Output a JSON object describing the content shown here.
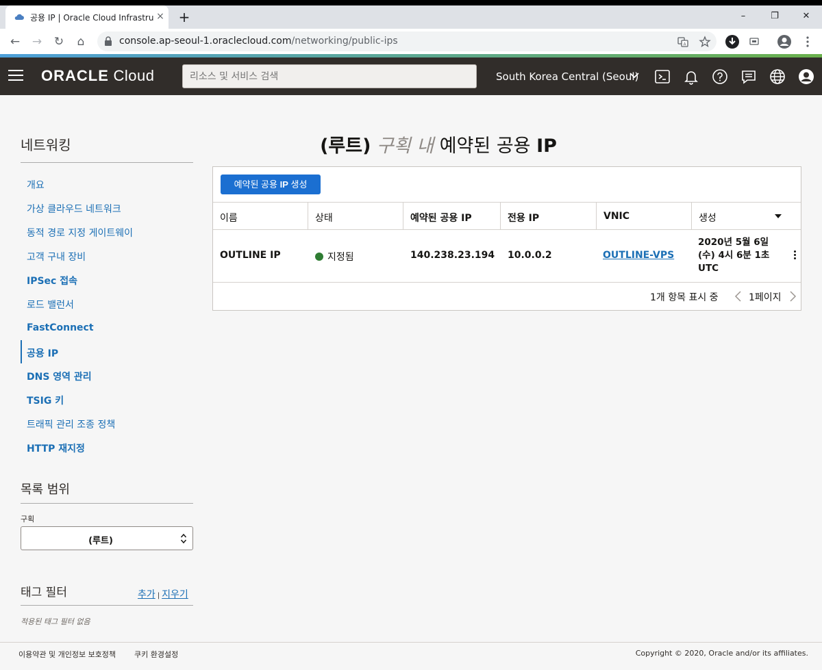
{
  "browser": {
    "tab_title": "공용 IP | Oracle Cloud Infrastruc",
    "tab_close": "×",
    "new_tab": "+",
    "window_controls": {
      "minimize": "–",
      "maximize": "❐",
      "close": "✕"
    },
    "url_host": "console.ap-seoul-1.oraclecloud.com",
    "url_path": "/networking/public-ips",
    "nav": {
      "back": "←",
      "forward": "→",
      "reload": "↻",
      "home": "⌂"
    },
    "toolbar_icons": [
      "translate-icon",
      "star-icon",
      "download-icon",
      "media-icon",
      "profile-icon",
      "menu-icon"
    ]
  },
  "header": {
    "brand_bold": "ORACLE",
    "brand_light": " Cloud",
    "search_placeholder": "리소스 및 서비스 검색",
    "region": "South Korea Central (Seoul)",
    "icons": [
      "cloud-shell-icon",
      "bell-icon",
      "help-icon",
      "chat-icon",
      "globe-icon",
      "user-icon"
    ]
  },
  "sidebar": {
    "title": "네트워킹",
    "items": [
      {
        "label": "개요",
        "bold": false
      },
      {
        "label": "가상 클라우드 네트워크",
        "bold": false
      },
      {
        "label": "동적 경로 지정 게이트웨이",
        "bold": false
      },
      {
        "label": "고객 구내 장비",
        "bold": false
      },
      {
        "label": "IPSec 접속",
        "bold": true
      },
      {
        "label": "로드 밸런서",
        "bold": false
      },
      {
        "label": "FastConnect",
        "bold": true
      },
      {
        "label": "공용 IP",
        "bold": true,
        "active": true
      },
      {
        "label": "DNS 영역 관리",
        "bold": true
      },
      {
        "label": "TSIG 키",
        "bold": true
      },
      {
        "label": "트래픽 관리 조종 정책",
        "bold": false
      },
      {
        "label": "HTTP 재지정",
        "bold": true
      }
    ],
    "scope_title": "목록 범위",
    "compartment_label": "구획",
    "compartment_value": "(루트)",
    "tag_filter_title": "태그 필터",
    "tag_add": "추가",
    "tag_sep": "|",
    "tag_clear": "지우기",
    "tag_empty": "적용된 태그 필터 없음"
  },
  "main": {
    "title_root": "(루트)",
    "title_in": " 구획 내 ",
    "title_rest": "예약된 공용 ",
    "title_ip": "IP",
    "create_button_prefix": "예약된 공용 ",
    "create_button_ip": "IP",
    "create_button_suffix": " 생성",
    "columns": [
      "이름",
      "상태",
      "예약된 공용 IP",
      "전용 IP",
      "VNIC",
      "생성"
    ],
    "rows": [
      {
        "name": "OUTLINE IP",
        "status": "지정됨",
        "status_color": "#2f7d33",
        "public_ip": "140.238.23.194",
        "private_ip": "10.0.0.2",
        "vnic": "OUTLINE-VPS",
        "created": "2020년 5월 6일 (수) 4시 6분 1초 UTC"
      }
    ],
    "pager_count": "1개 항목 표시 중",
    "pager_page": "1페이지"
  },
  "footer": {
    "terms": "이용약관 및 개인정보 보호정책",
    "cookies": "쿠키 환경설정",
    "copyright": "Copyright © 2020, Oracle and/or its affiliates."
  },
  "colors": {
    "header_bg": "#312d2a",
    "link": "#1b6fb5",
    "primary_button": "#1b6fd1",
    "status_available": "#2f7d33"
  }
}
